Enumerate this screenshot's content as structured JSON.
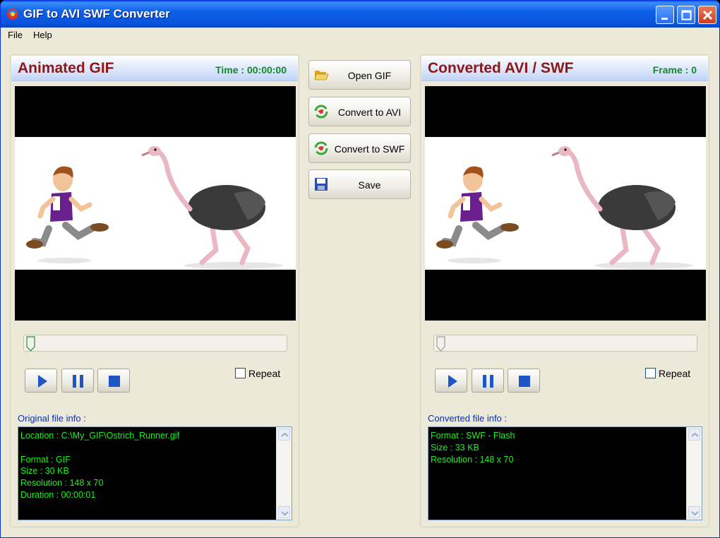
{
  "window": {
    "title": "GIF to AVI SWF Converter",
    "accent": "#0653d8"
  },
  "menu": [
    "File",
    "Help"
  ],
  "left_panel": {
    "title": "Animated GIF",
    "meta": "Time : 00:00:00",
    "repeat_label": "Repeat",
    "repeat_checked": false,
    "playback_position": 0,
    "info_label": "Original file info :",
    "info_text": "Location : C:\\My_GIF\\Ostrich_Runner.gif\n\nFormat : GIF\nSize : 30 KB\nResolution : 148 x 70\nDuration : 00:00:01"
  },
  "right_panel": {
    "title": "Converted AVI / SWF",
    "meta": "Frame : 0",
    "repeat_label": "Repeat",
    "repeat_checked": false,
    "playback_position": 0,
    "info_label": "Converted file info :",
    "info_text": "Format : SWF - Flash\nSize : 33 KB\nResolution : 148 x 70"
  },
  "actions": {
    "open": "Open  GIF",
    "to_avi": "Convert to AVI",
    "to_swf": "Convert to SWF",
    "save": "Save"
  },
  "colors": {
    "panel_title": "#8b1818",
    "meta": "#138a2a",
    "info_text": "#1ef01e",
    "info_label": "#0d2fa8"
  }
}
